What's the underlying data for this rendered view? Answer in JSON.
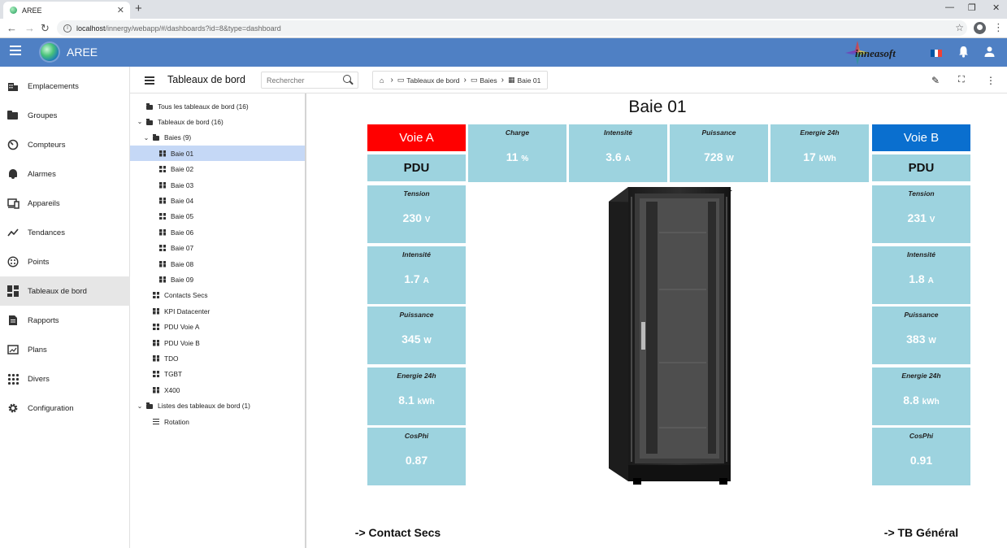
{
  "browser": {
    "tab_title": "AREE",
    "url_host": "localhost",
    "url_path": "/innergy/webapp/#/dashboards?id=8&type=dashboard"
  },
  "app": {
    "title": "AREE",
    "brand": "inneasoft"
  },
  "nav": {
    "items": [
      {
        "label": "Emplacements",
        "icon": "building-icon"
      },
      {
        "label": "Groupes",
        "icon": "folder-icon"
      },
      {
        "label": "Compteurs",
        "icon": "gauge-icon"
      },
      {
        "label": "Alarmes",
        "icon": "bell-icon"
      },
      {
        "label": "Appareils",
        "icon": "devices-icon"
      },
      {
        "label": "Tendances",
        "icon": "trend-icon"
      },
      {
        "label": "Points",
        "icon": "points-icon"
      },
      {
        "label": "Tableaux de bord",
        "icon": "dashboard-icon"
      },
      {
        "label": "Rapports",
        "icon": "report-icon"
      },
      {
        "label": "Plans",
        "icon": "plan-icon"
      },
      {
        "label": "Divers",
        "icon": "apps-icon"
      },
      {
        "label": "Configuration",
        "icon": "gear-icon"
      }
    ],
    "active_index": 7
  },
  "toolbar": {
    "title": "Tableaux de bord",
    "search_placeholder": "Rechercher",
    "breadcrumb": [
      "Tableaux de bord",
      "Baies",
      "Baie 01"
    ]
  },
  "tree": {
    "rows": [
      {
        "label": "Tous les tableaux de bord (16)",
        "type": "folder",
        "level": 0,
        "chevron": ""
      },
      {
        "label": "Tableaux de bord (16)",
        "type": "folder",
        "level": 0,
        "chevron": "v"
      },
      {
        "label": "Baies (9)",
        "type": "folder",
        "level": 1,
        "chevron": "v"
      },
      {
        "label": "Baie 01",
        "type": "dash",
        "level": 2,
        "chevron": ""
      },
      {
        "label": "Baie 02",
        "type": "dash",
        "level": 2,
        "chevron": ""
      },
      {
        "label": "Baie 03",
        "type": "dash",
        "level": 2,
        "chevron": ""
      },
      {
        "label": "Baie 04",
        "type": "dash",
        "level": 2,
        "chevron": ""
      },
      {
        "label": "Baie 05",
        "type": "dash",
        "level": 2,
        "chevron": ""
      },
      {
        "label": "Baie 06",
        "type": "dash",
        "level": 2,
        "chevron": ""
      },
      {
        "label": "Baie 07",
        "type": "dash",
        "level": 2,
        "chevron": ""
      },
      {
        "label": "Baie 08",
        "type": "dash",
        "level": 2,
        "chevron": ""
      },
      {
        "label": "Baie 09",
        "type": "dash",
        "level": 2,
        "chevron": ""
      },
      {
        "label": "Contacts Secs",
        "type": "dash",
        "level": 1,
        "chevron": ""
      },
      {
        "label": "KPI Datacenter",
        "type": "dash",
        "level": 1,
        "chevron": ""
      },
      {
        "label": "PDU Voie A",
        "type": "dash",
        "level": 1,
        "chevron": ""
      },
      {
        "label": "PDU Voie B",
        "type": "dash",
        "level": 1,
        "chevron": ""
      },
      {
        "label": "TDO",
        "type": "dash",
        "level": 1,
        "chevron": ""
      },
      {
        "label": "TGBT",
        "type": "dash",
        "level": 1,
        "chevron": ""
      },
      {
        "label": "X400",
        "type": "dash",
        "level": 1,
        "chevron": ""
      },
      {
        "label": "Listes des tableaux de bord (1)",
        "type": "folder",
        "level": 0,
        "chevron": "v"
      },
      {
        "label": "Rotation",
        "type": "list",
        "level": 1,
        "chevron": ""
      }
    ],
    "selected_index": 3
  },
  "dashboard": {
    "title": "Baie 01",
    "voie_a": {
      "label": "Voie A",
      "color": "#ff0000",
      "pdu": "PDU"
    },
    "voie_b": {
      "label": "Voie B",
      "color": "#0a6fcf",
      "pdu": "PDU"
    },
    "summary": [
      {
        "label": "Charge",
        "value": "11",
        "unit": "%"
      },
      {
        "label": "Intensité",
        "value": "3.6",
        "unit": "A"
      },
      {
        "label": "Puissance",
        "value": "728",
        "unit": "W"
      },
      {
        "label": "Energie 24h",
        "value": "17",
        "unit": "kWh"
      }
    ],
    "left_tiles": [
      {
        "label": "Tension",
        "value": "230",
        "unit": "V"
      },
      {
        "label": "Intensité",
        "value": "1.7",
        "unit": "A"
      },
      {
        "label": "Puissance",
        "value": "345",
        "unit": "W"
      },
      {
        "label": "Energie 24h",
        "value": "8.1",
        "unit": "kWh"
      },
      {
        "label": "CosPhi",
        "value": "0.87",
        "unit": ""
      }
    ],
    "right_tiles": [
      {
        "label": "Tension",
        "value": "231",
        "unit": "V"
      },
      {
        "label": "Intensité",
        "value": "1.8",
        "unit": "A"
      },
      {
        "label": "Puissance",
        "value": "383",
        "unit": "W"
      },
      {
        "label": "Energie 24h",
        "value": "8.8",
        "unit": "kWh"
      },
      {
        "label": "CosPhi",
        "value": "0.91",
        "unit": ""
      }
    ],
    "link_left": "-> Contact Secs",
    "link_right": "-> TB Général",
    "tile_color": "#9dd3df"
  }
}
